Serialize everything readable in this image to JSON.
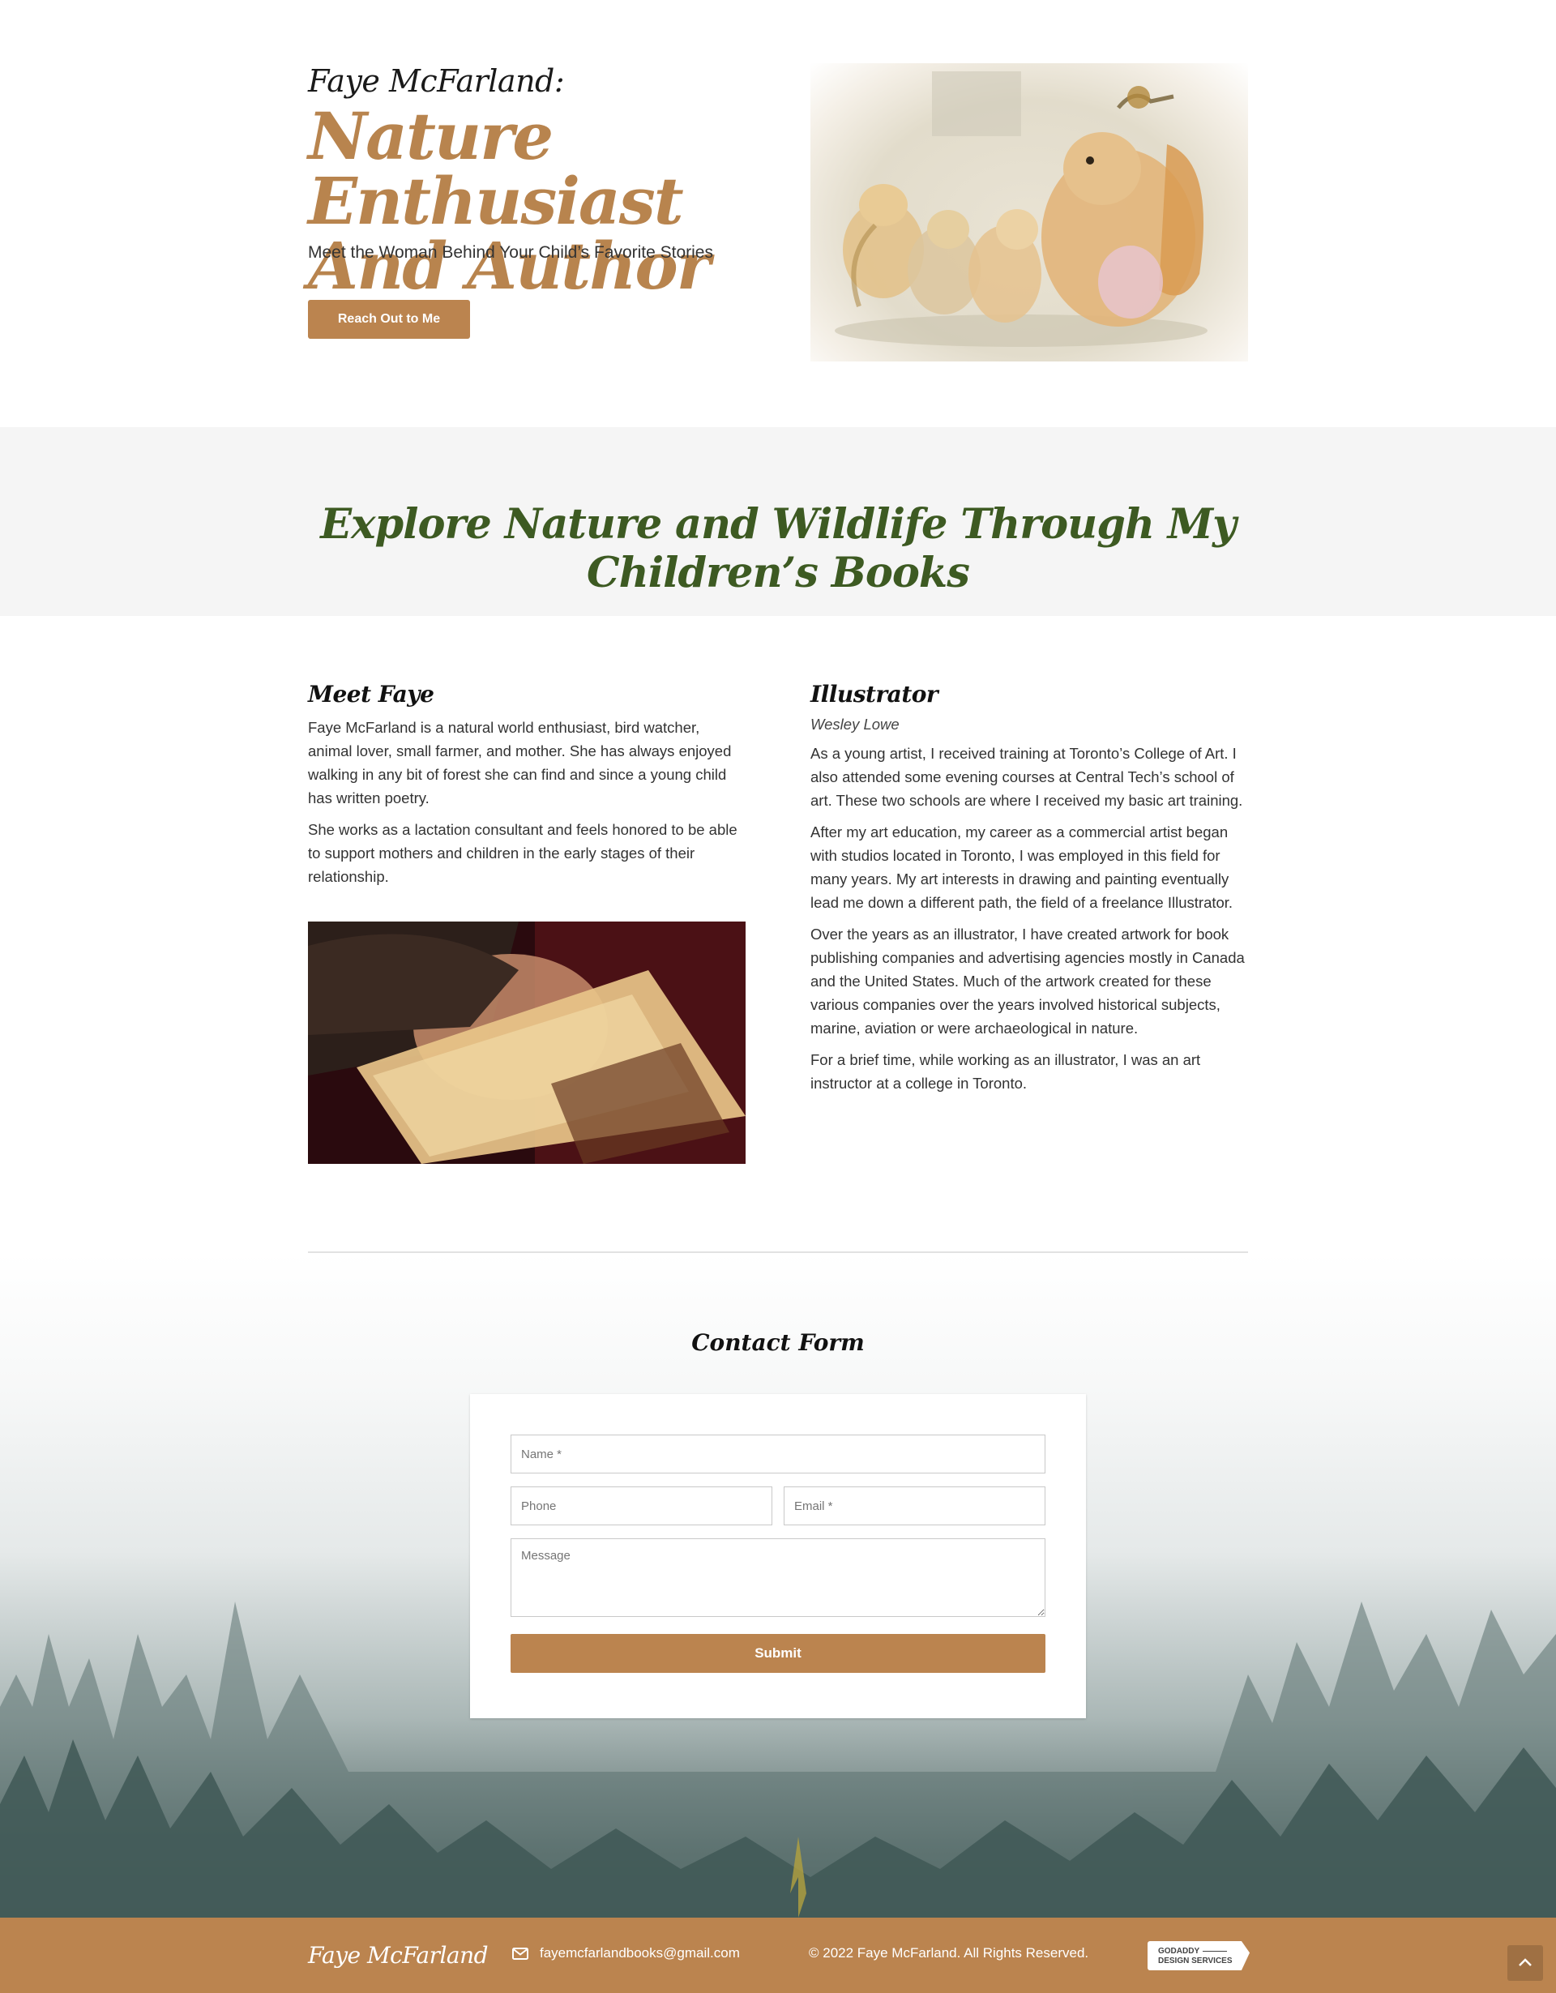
{
  "hero": {
    "name": "Faye McFarland:",
    "title": "Nature Enthusiast And Author",
    "subtitle": "Meet the Woman Behind Your Child’s Favorite Stories",
    "cta_label": "Reach Out to Me"
  },
  "banner": {
    "heading": "Explore Nature and Wildlife Through My Children’s Books"
  },
  "meet": {
    "heading": "Meet Faye",
    "paragraphs": [
      "Faye McFarland is a natural world enthusiast, bird watcher, animal lover, small farmer, and mother. She has always enjoyed walking in any bit of forest she can find and since a young child has written poetry.",
      "She works as a lactation consultant and feels honored to be able to support mothers and children in the early stages of their relationship."
    ]
  },
  "illustrator": {
    "heading": "Illustrator",
    "name": "Wesley Lowe",
    "paragraphs": [
      "As a young artist, I received training at Toronto’s College of Art. I also attended some evening courses at Central Tech’s school of art. These two schools are where I received my basic art training.",
      "After my art education, my career as a commercial artist began with studios located in Toronto, I was employed in this field for many years. My art interests in drawing and painting eventually lead me down a different path, the field of a freelance Illustrator.",
      "Over the years as an illustrator, I have created artwork for book publishing companies and advertising agencies mostly in Canada and the United States. Much of the artwork created for these various companies over the years involved historical subjects, marine, aviation or were archaeological in nature.",
      "For a brief time, while working as an illustrator, I was an art instructor at a college in Toronto."
    ]
  },
  "contact": {
    "heading": "Contact Form",
    "name_placeholder": "Name *",
    "phone_placeholder": "Phone",
    "email_placeholder": "Email *",
    "message_placeholder": "Message",
    "submit_label": "Submit"
  },
  "footer": {
    "brand": "Faye McFarland",
    "email": "fayemcfarlandbooks@gmail.com",
    "copyright": "© 2022 Faye McFarland. All Rights Reserved.",
    "badge_line1": "GODADDY",
    "badge_line2": "DESIGN SERVICES"
  },
  "colors": {
    "accent": "#bb844f",
    "banner_text": "#3d5a22",
    "banner_bg": "#f5f5f5"
  },
  "icons": [
    "mail-icon",
    "chevron-up-icon"
  ]
}
